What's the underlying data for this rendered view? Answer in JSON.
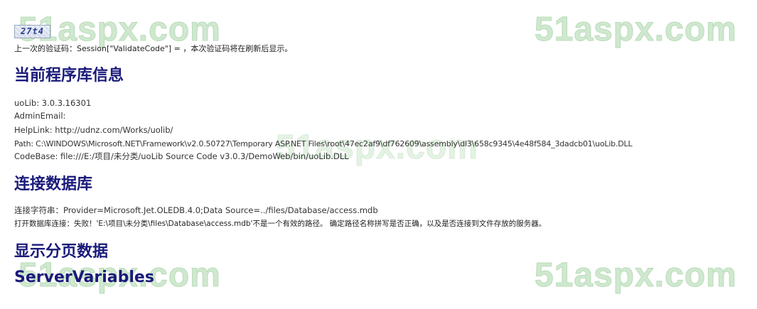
{
  "watermark": {
    "text": "51aspx.com"
  },
  "captcha": {
    "text": "27t4"
  },
  "validate_line": "上一次的验证码：Session[\"ValidateCode\"] = ，本次验证码将在刷新后显示。",
  "sections": {
    "library": {
      "heading": "当前程序库信息",
      "uolib": "uoLib: 3.0.3.16301",
      "admin_email": "AdminEmail:",
      "help_link": "HelpLink: http://udnz.com/Works/uolib/",
      "path": "Path: C:\\WINDOWS\\Microsoft.NET\\Framework\\v2.0.50727\\Temporary ASP.NET Files\\root\\47ec2af9\\df762609\\assembly\\dl3\\658c9345\\4e48f584_3dadcb01\\uoLib.DLL",
      "codebase": "CodeBase: file:///E:/项目/未分类/uoLib Source Code v3.0.3/DemoWeb/bin/uoLib.DLL"
    },
    "database": {
      "heading": "连接数据库",
      "connection_string": "连接字符串：Provider=Microsoft.Jet.OLEDB.4.0;Data Source=../files/Database/access.mdb",
      "open_result": "打开数据库连接：失败！'E:\\项目\\未分类\\files\\Database\\access.mdb'不是一个有效的路径。 确定路径名称拼写是否正确，以及是否连接到文件存放的服务器。"
    },
    "paging": {
      "heading": "显示分页数据"
    },
    "server_variables": {
      "heading": "ServerVariables"
    }
  }
}
